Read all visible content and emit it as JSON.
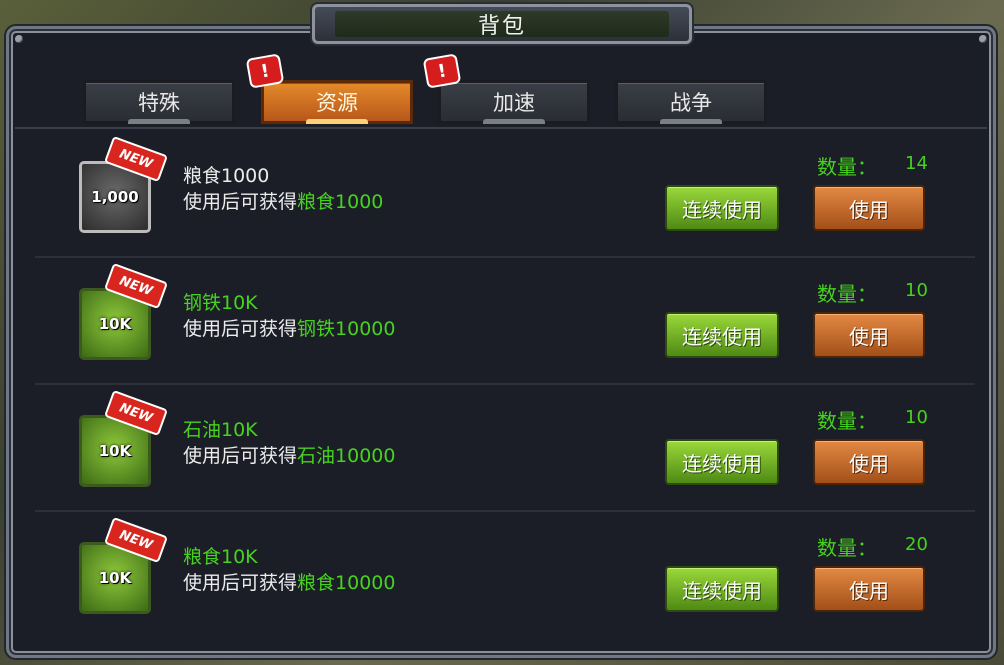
{
  "window": {
    "title": "背包"
  },
  "tabs": [
    {
      "label": "特殊",
      "active": false,
      "alert": false
    },
    {
      "label": "资源",
      "active": true,
      "alert": true
    },
    {
      "label": "加速",
      "active": false,
      "alert": true
    },
    {
      "label": "战争",
      "active": false,
      "alert": false
    }
  ],
  "alert_glyph": "!",
  "new_badge": "NEW",
  "qty_label": "数量：",
  "items": [
    {
      "icon_text": "1,000",
      "icon_name": "grain-icon",
      "name": "粮食1000",
      "desc_prefix": "使用后可获得",
      "desc_highlight": "粮食1000",
      "quantity": "14",
      "continue_label": "连续使用",
      "use_label": "使用"
    },
    {
      "icon_text": "10K",
      "icon_name": "steel-icon",
      "name": "钢铁10K",
      "desc_prefix": "使用后可获得",
      "desc_highlight": "钢铁10000",
      "quantity": "10",
      "continue_label": "连续使用",
      "use_label": "使用"
    },
    {
      "icon_text": "10K",
      "icon_name": "oil-icon",
      "name": "石油10K",
      "desc_prefix": "使用后可获得",
      "desc_highlight": "石油10000",
      "quantity": "10",
      "continue_label": "连续使用",
      "use_label": "使用"
    },
    {
      "icon_text": "10K",
      "icon_name": "grain-icon",
      "name": "粮食10K",
      "desc_prefix": "使用后可获得",
      "desc_highlight": "粮食10000",
      "quantity": "20",
      "continue_label": "连续使用",
      "use_label": "使用"
    }
  ],
  "colors": {
    "accent_green": "#46d21e",
    "tab_active": "#e58a2a",
    "panel": "#1b1e26"
  }
}
